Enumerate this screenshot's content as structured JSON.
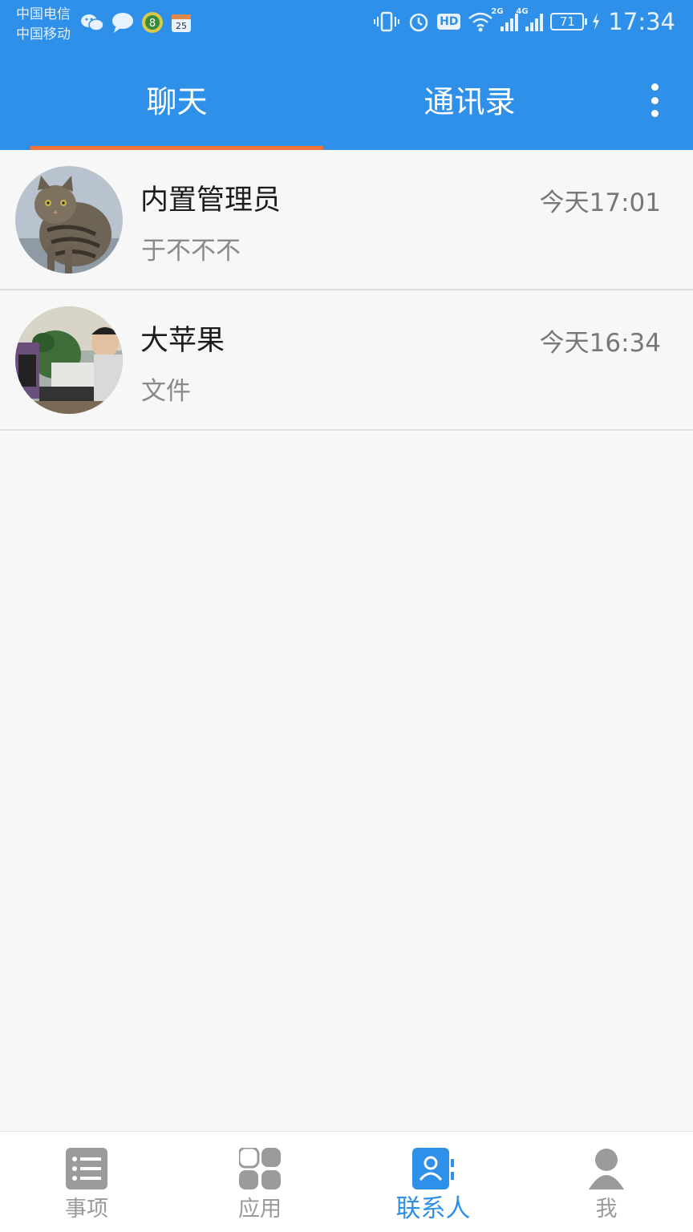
{
  "status_bar": {
    "carrier_1": "中国电信",
    "carrier_2": "中国移动",
    "hd": "HD",
    "signal_1_label": "2G",
    "signal_2_label": "4G",
    "battery": "71",
    "time": "17:34"
  },
  "header": {
    "tabs": [
      {
        "label": "聊天",
        "active": true
      },
      {
        "label": "通讯录",
        "active": false
      }
    ],
    "accent_color": "#2f90ea",
    "underline_color": "#f2733a"
  },
  "conversations": [
    {
      "name": "内置管理员",
      "time": "今天17:01",
      "preview": "于不不不",
      "avatar": "cat-photo"
    },
    {
      "name": "大苹果",
      "time": "今天16:34",
      "preview": "文件",
      "avatar": "person-photo"
    }
  ],
  "bottom_nav": {
    "items": [
      {
        "label": "事项",
        "icon": "list-icon",
        "active": false
      },
      {
        "label": "应用",
        "icon": "apps-grid-icon",
        "active": false
      },
      {
        "label": "联系人",
        "icon": "contacts-icon",
        "active": true
      },
      {
        "label": "我",
        "icon": "person-icon",
        "active": false
      }
    ]
  }
}
